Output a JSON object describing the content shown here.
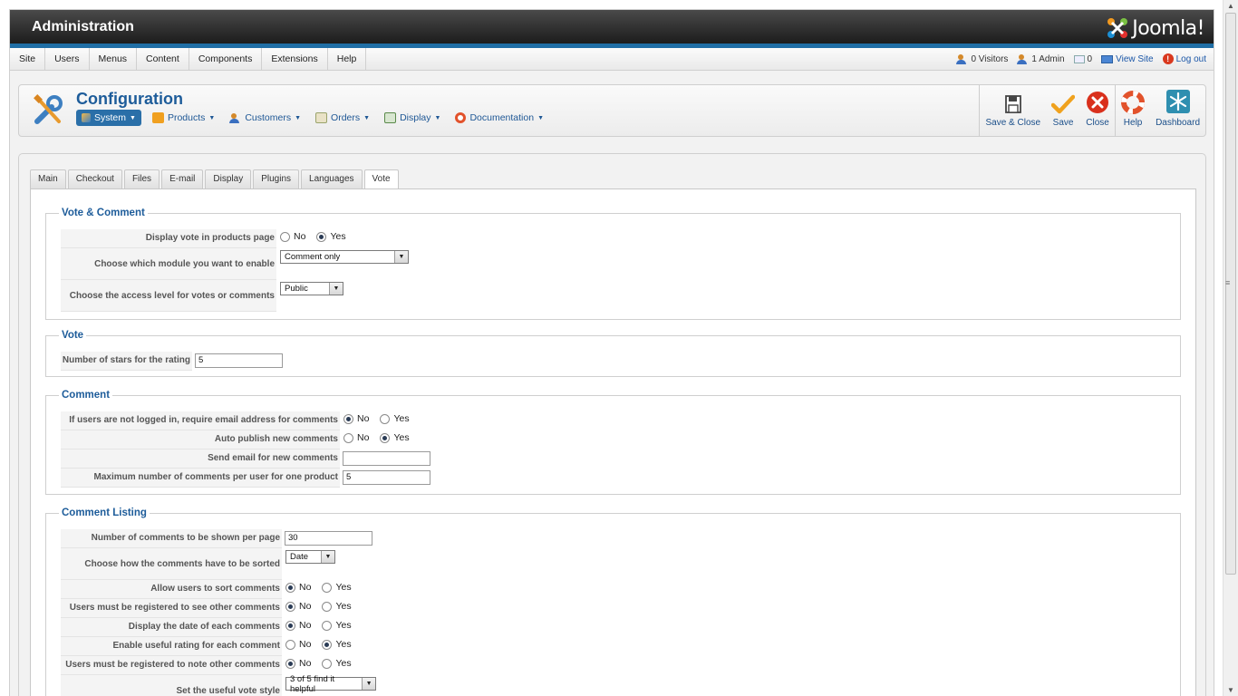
{
  "header": {
    "title": "Administration",
    "logo_text": "Joomla!"
  },
  "menubar": {
    "items": [
      "Site",
      "Users",
      "Menus",
      "Content",
      "Components",
      "Extensions",
      "Help"
    ],
    "status": {
      "visitors": "0 Visitors",
      "admins": "1 Admin",
      "messages": "0",
      "view_site": "View Site",
      "logout": "Log out"
    }
  },
  "toolbar": {
    "title": "Configuration",
    "submenu": [
      {
        "label": "System",
        "icon": "wrench-icon"
      },
      {
        "label": "Products",
        "icon": "box-icon"
      },
      {
        "label": "Customers",
        "icon": "people-icon"
      },
      {
        "label": "Orders",
        "icon": "orders-icon"
      },
      {
        "label": "Display",
        "icon": "display-icon"
      },
      {
        "label": "Documentation",
        "icon": "lifebuoy-icon"
      }
    ],
    "actions": {
      "save_close": "Save & Close",
      "save": "Save",
      "close": "Close",
      "help": "Help",
      "dashboard": "Dashboard"
    }
  },
  "tabs": [
    "Main",
    "Checkout",
    "Files",
    "E-mail",
    "Display",
    "Plugins",
    "Languages",
    "Vote"
  ],
  "active_tab": "Vote",
  "radio_labels": {
    "no": "No",
    "yes": "Yes"
  },
  "sections": {
    "vote_comment": {
      "legend": "Vote & Comment",
      "display_vote_label": "Display vote in products page",
      "display_vote_value": "Yes",
      "module_label": "Choose which module you want to enable",
      "module_value": "Comment only",
      "access_label": "Choose the access level for votes or comments",
      "access_value": "Public"
    },
    "vote": {
      "legend": "Vote",
      "stars_label": "Number of stars for the rating",
      "stars_value": "5"
    },
    "comment": {
      "legend": "Comment",
      "require_email_label": "If users are not logged in, require email address for comments",
      "require_email_value": "No",
      "auto_publish_label": "Auto publish new comments",
      "auto_publish_value": "Yes",
      "send_email_label": "Send email for new comments",
      "send_email_value": "",
      "max_comments_label": "Maximum number of comments per user for one product",
      "max_comments_value": "5"
    },
    "comment_listing": {
      "legend": "Comment Listing",
      "per_page_label": "Number of comments to be shown per page",
      "per_page_value": "30",
      "sort_label": "Choose how the comments have to be sorted",
      "sort_value": "Date",
      "allow_sort_label": "Allow users to sort comments",
      "allow_sort_value": "No",
      "registered_see_label": "Users must be registered to see other comments",
      "registered_see_value": "No",
      "display_date_label": "Display the date of each comments",
      "display_date_value": "No",
      "useful_rating_label": "Enable useful rating for each comment",
      "useful_rating_value": "Yes",
      "registered_note_label": "Users must be registered to note other comments",
      "registered_note_value": "No",
      "vote_style_label": "Set the useful vote style",
      "vote_style_value": "3 of 5 find it helpful"
    }
  }
}
